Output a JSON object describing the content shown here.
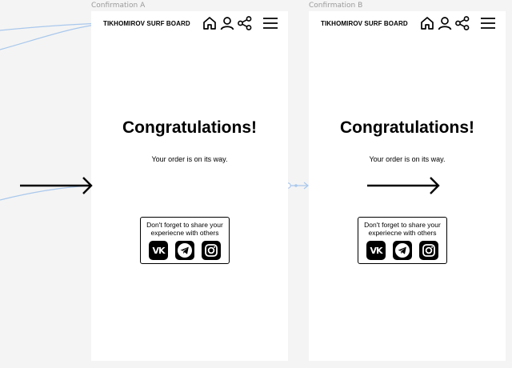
{
  "frames": [
    {
      "label": "Confirmation A",
      "brand": "TIKHOMIROV SURF BOARD",
      "title": "Congratulations!",
      "subtitle": "Your order is on its way.",
      "share_text": "Don't forget to share your experiecne with others",
      "icons": [
        "home-icon",
        "user-icon",
        "share-icon",
        "menu-icon",
        "arrow-right-icon",
        "vk-icon",
        "telegram-icon",
        "instagram-icon"
      ]
    },
    {
      "label": "Confirmation B",
      "brand": "TIKHOMIROV SURF BOARD",
      "title": "Congratulations!",
      "subtitle": "Your order is on its way.",
      "share_text": "Don't forget to share your experiecne with others",
      "icons": [
        "home-icon",
        "user-icon",
        "share-icon",
        "menu-icon",
        "arrow-right-icon",
        "vk-icon",
        "telegram-icon",
        "instagram-icon"
      ]
    }
  ],
  "social_labels": {
    "vk": "VK"
  },
  "colors": {
    "canvas": "#f4f4f4",
    "artboard": "#ffffff",
    "ink": "#000000",
    "prototype_wire": "#a9c8ec"
  }
}
